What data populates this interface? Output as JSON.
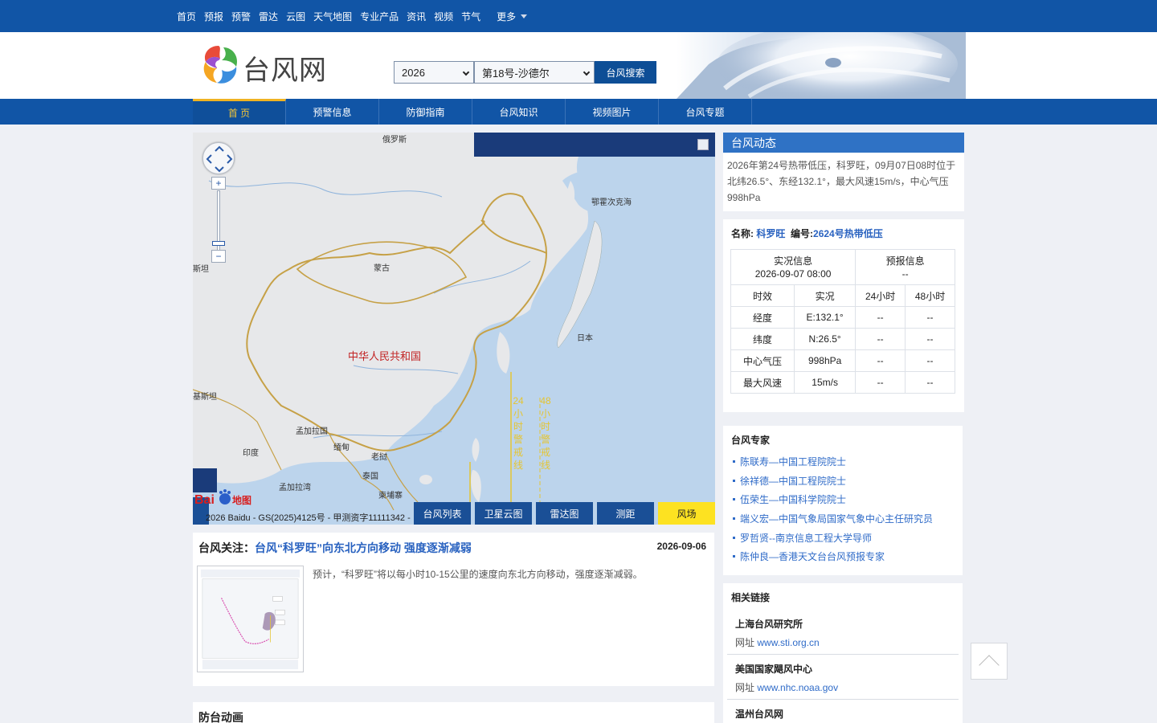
{
  "topnav": {
    "items": [
      "首页",
      "预报",
      "预警",
      "雷达",
      "云图",
      "天气地图",
      "专业产品",
      "资讯",
      "视频",
      "节气"
    ],
    "more": "更多"
  },
  "header": {
    "logo_text": "台风网",
    "year": "2026",
    "storm": "第18号-沙德尔",
    "search_label": "台风搜索"
  },
  "mainnav": {
    "tabs": [
      "首 页",
      "预警信息",
      "防御指南",
      "台风知识",
      "视频图片",
      "台风专题"
    ]
  },
  "map": {
    "labels": {
      "russia": "俄罗斯",
      "okhotsk": "鄂霍次克海",
      "mongolia": "蒙古",
      "china": "中华人民共和国",
      "japan": "日本",
      "kazakh": "斯坦",
      "pakistan": "基斯坦",
      "bangladesh": "孟加拉国",
      "myanmar": "缅甸",
      "india": "印度",
      "laos": "老挝",
      "thailand": "泰国",
      "bay": "孟加拉湾",
      "cambodia": "柬埔寨"
    },
    "line24": [
      "24",
      "小",
      "时",
      "警",
      "戒",
      "线"
    ],
    "line48": [
      "48",
      "小",
      "时",
      "警",
      "戒",
      "线"
    ],
    "copyright": "2026 Baidu - GS(2025)4125号 - 甲测资字11111342 -",
    "baidu_logo": "Bai地图",
    "buttons": [
      "台风列表",
      "卫星云图",
      "雷达图",
      "测距",
      "风场"
    ]
  },
  "dynamic": {
    "title": "台风动态",
    "text": "2026年第24号热带低压，科罗旺，09月07日08时位于北纬26.5°、东经132.1°，最大风速15m/s，中心气压998hPa"
  },
  "info": {
    "name_label": "名称:",
    "name_value": "科罗旺",
    "code_label": "编号:",
    "code_value": "2624号热带低压",
    "actual_head": "实况信息",
    "actual_time": "2026-09-07 08:00",
    "forecast_head": "预报信息",
    "forecast_time": "--",
    "cols": [
      "时效",
      "实况",
      "24小时",
      "48小时"
    ],
    "rows": [
      [
        "经度",
        "E:132.1°",
        "--",
        "--"
      ],
      [
        "纬度",
        "N:26.5°",
        "--",
        "--"
      ],
      [
        "中心气压",
        "998hPa",
        "--",
        "--"
      ],
      [
        "最大风速",
        "15m/s",
        "--",
        "--"
      ]
    ]
  },
  "experts": {
    "title": "台风专家",
    "items": [
      "陈联寿—中国工程院院士",
      "徐祥德—中国工程院院士",
      "伍荣生—中国科学院院士",
      "端义宏—中国气象局国家气象中心主任研究员",
      "罗哲贤--南京信息工程大学导师",
      "陈仲良—香港天文台台风预报专家"
    ]
  },
  "links": {
    "title": "相关链接",
    "url_label": "网址",
    "items": [
      {
        "name": "上海台风研究所",
        "url": "www.sti.org.cn"
      },
      {
        "name": "美国国家飓风中心",
        "url": "www.nhc.noaa.gov"
      },
      {
        "name": "温州台风网",
        "url": ""
      }
    ]
  },
  "news": {
    "prefix": "台风关注：",
    "headline": "台风“科罗旺”向东北方向移动 强度逐渐减弱",
    "date": "2026-09-06",
    "summary": "预计，“科罗旺”将以每小时10-15公里的速度向东北方向移动，强度逐渐减弱。"
  },
  "animation": {
    "title": "防台动画"
  },
  "colors": {
    "nav_blue": "#1155a6",
    "accent_yellow": "#f3c437",
    "link_blue": "#2962c0"
  }
}
